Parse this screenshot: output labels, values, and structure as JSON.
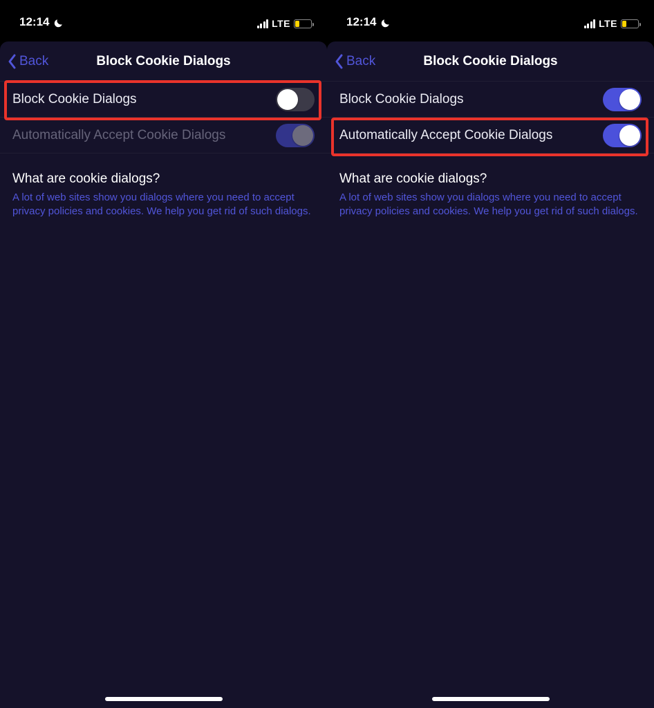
{
  "status": {
    "time": "12:14",
    "carrier": "LTE",
    "battery_pct": 25
  },
  "nav": {
    "back_label": "Back",
    "title": "Block Cookie Dialogs"
  },
  "left_screen": {
    "row1": {
      "label": "Block Cookie Dialogs",
      "state": "off",
      "highlighted": true
    },
    "row2": {
      "label": "Automatically Accept Cookie Dialogs",
      "state": "on-disabled",
      "highlighted": false
    }
  },
  "right_screen": {
    "row1": {
      "label": "Block Cookie Dialogs",
      "state": "on",
      "highlighted": false
    },
    "row2": {
      "label": "Automatically Accept Cookie Dialogs",
      "state": "on",
      "highlighted": true
    }
  },
  "info": {
    "heading": "What are cookie dialogs?",
    "body": "A lot of web sites show you dialogs where you need to accept privacy policies and cookies. We help you get rid of such dialogs."
  },
  "colors": {
    "accent": "#5155d9",
    "highlight": "#e9332b",
    "panel_bg": "#15122a"
  }
}
